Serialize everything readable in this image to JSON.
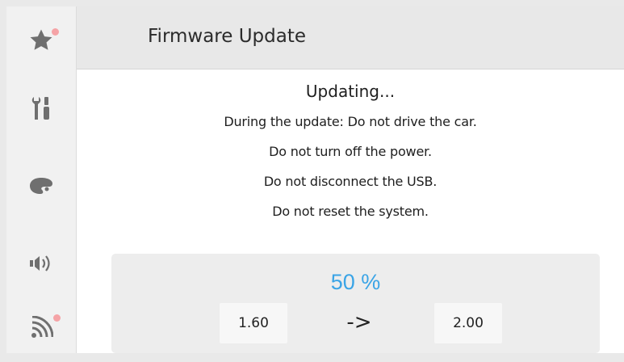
{
  "header": {
    "title": "Firmware Update"
  },
  "sidebar": {
    "items": [
      {
        "icon": "star-icon",
        "notification": true
      },
      {
        "icon": "tools-icon",
        "notification": false
      },
      {
        "icon": "palette-icon",
        "notification": false
      },
      {
        "icon": "speaker-icon",
        "notification": false
      },
      {
        "icon": "wireless-icon",
        "notification": true
      }
    ]
  },
  "message": {
    "title": "Updating...",
    "lines": [
      "During the update: Do not drive the car.",
      "Do not turn off the power.",
      "Do not disconnect the USB.",
      "Do not reset the system."
    ]
  },
  "progress": {
    "percent_text": "50 %",
    "from_version": "1.60",
    "arrow": "->",
    "to_version": "2.00"
  },
  "colors": {
    "accent": "#3aa4e6",
    "notification_dot": "#f5a3a6",
    "icon": "#6f6f6f"
  }
}
